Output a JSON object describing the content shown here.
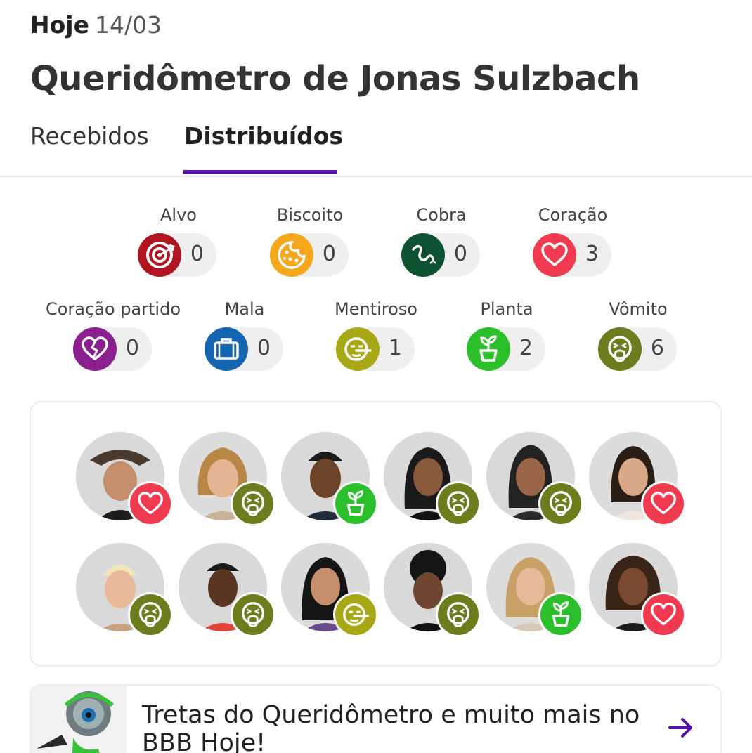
{
  "header": {
    "today_label": "Hoje",
    "date": "14/03",
    "title": "Queridômetro de Jonas Sulzbach"
  },
  "tabs": [
    {
      "label": "Recebidos",
      "active": false
    },
    {
      "label": "Distribuídos",
      "active": true
    }
  ],
  "reactions": [
    {
      "name": "Alvo",
      "count": "0",
      "icon": "target-icon",
      "color": "#b0151f"
    },
    {
      "name": "Biscoito",
      "count": "0",
      "icon": "cookie-icon",
      "color": "#f5a61b"
    },
    {
      "name": "Cobra",
      "count": "0",
      "icon": "snake-icon",
      "color": "#0d5330"
    },
    {
      "name": "Coração",
      "count": "3",
      "icon": "heart-icon",
      "color": "#f03a4f"
    },
    {
      "name": "Coração partido",
      "count": "0",
      "icon": "broken-heart-icon",
      "color": "#8a1f8f"
    },
    {
      "name": "Mala",
      "count": "0",
      "icon": "suitcase-icon",
      "color": "#1565b0"
    },
    {
      "name": "Mentiroso",
      "count": "1",
      "icon": "liar-face-icon",
      "color": "#a8a816"
    },
    {
      "name": "Planta",
      "count": "2",
      "icon": "plant-icon",
      "color": "#2bbf2b"
    },
    {
      "name": "Vômito",
      "count": "6",
      "icon": "vomit-face-icon",
      "color": "#6b7d1c"
    }
  ],
  "participants": [
    {
      "reaction": "Coração"
    },
    {
      "reaction": "Vômito"
    },
    {
      "reaction": "Planta"
    },
    {
      "reaction": "Vômito"
    },
    {
      "reaction": "Vômito"
    },
    {
      "reaction": "Coração"
    },
    {
      "reaction": "Vômito"
    },
    {
      "reaction": "Vômito"
    },
    {
      "reaction": "Mentiroso"
    },
    {
      "reaction": "Vômito"
    },
    {
      "reaction": "Planta"
    },
    {
      "reaction": "Coração"
    }
  ],
  "promo": {
    "text": "Tretas do Queridômetro e muito mais no BBB Hoje!",
    "arrow_icon": "arrow-right-icon",
    "accent": "#5a0fb0"
  }
}
